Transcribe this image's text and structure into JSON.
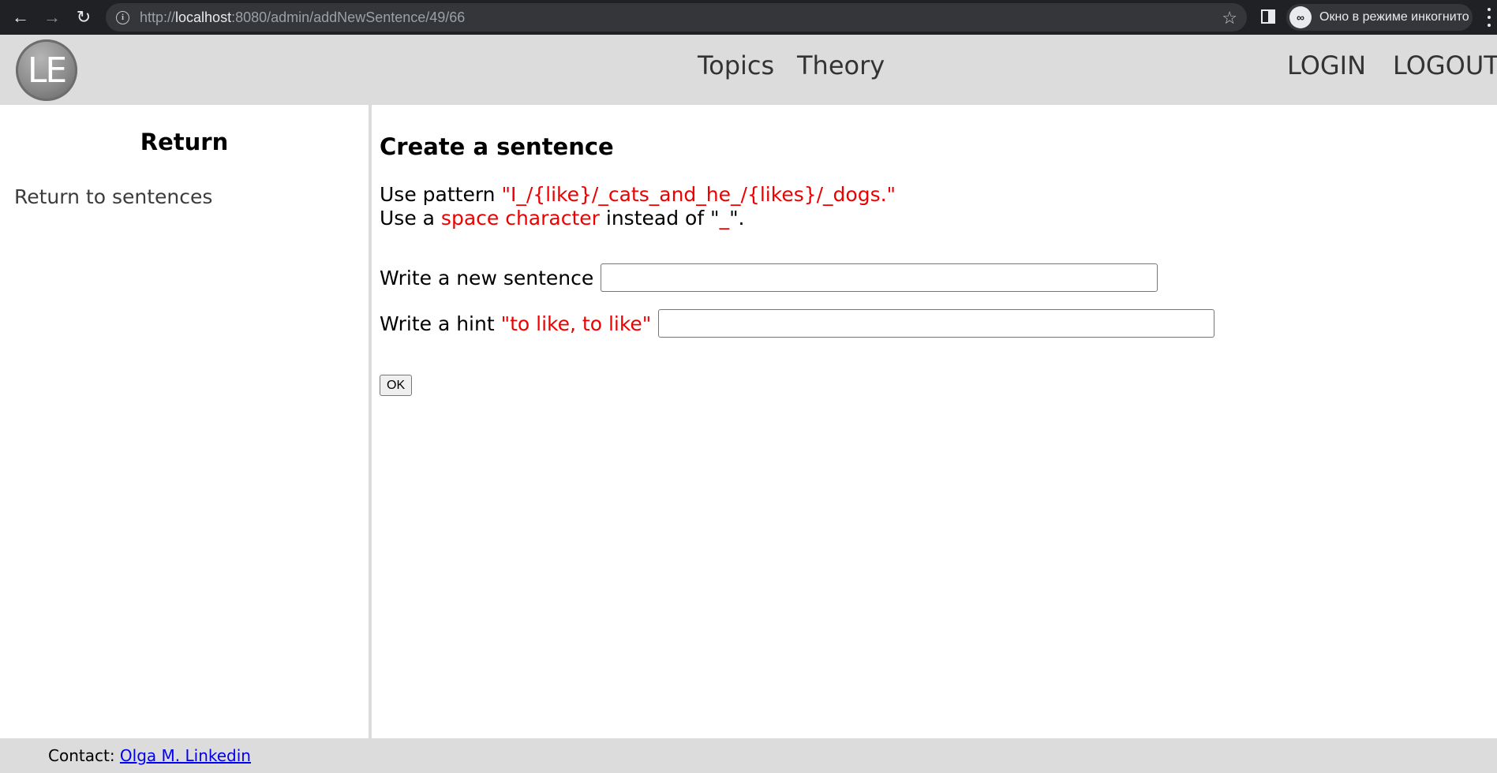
{
  "browser": {
    "url_prefix": "http://",
    "url_host": "localhost",
    "url_rest": ":8080/admin/addNewSentence/49/66",
    "incognito_label": "Окно в режиме инкогнито"
  },
  "header": {
    "logo_text": "LE",
    "nav": {
      "topics": "Topics",
      "theory": "Theory",
      "login": "LOGIN",
      "logout": "LOGOUT"
    }
  },
  "sidebar": {
    "title": "Return",
    "link": "Return to sentences"
  },
  "main": {
    "title": "Create a sentence",
    "pattern_prefix": "Use pattern ",
    "pattern_value": "\"I_/{like}/_cats_and_he_/{likes}/_dogs.\"",
    "space_prefix": "Use a ",
    "space_red": "space character",
    "space_middle": " instead of \"",
    "space_char": "_",
    "space_suffix": "\".",
    "sentence_label": "Write a new sentence",
    "sentence_value": "",
    "hint_label_prefix": "Write a hint ",
    "hint_value_shown": "\"to like, to like\"",
    "hint_input_value": "",
    "ok_label": "OK"
  },
  "footer": {
    "contact_label": "Contact: ",
    "contact_link": "Olga M. Linkedin"
  },
  "colors": {
    "header_bg": "#dcdcdc",
    "accent_red": "#ee0000",
    "link_blue": "#0000ee"
  }
}
